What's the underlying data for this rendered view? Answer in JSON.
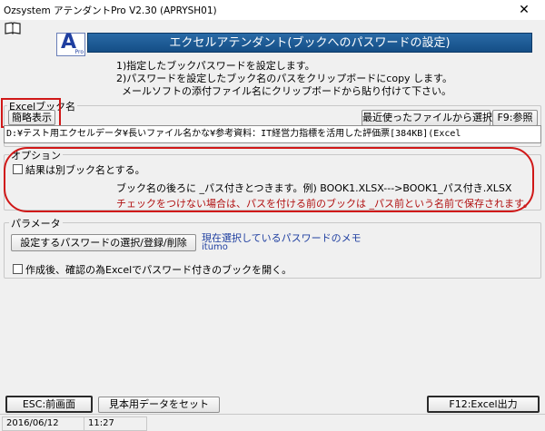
{
  "window": {
    "title": "Ozsystem アテンダントPro V2.30 (APRYSH01)",
    "close_glyph": "✕"
  },
  "header": {
    "logo_letter": "A",
    "logo_sub": "Pro",
    "banner": "エクセルアテンダント(ブックへのパスワードの設定)"
  },
  "instructions": [
    "1)指定したブックパスワードを設定します。",
    "2)パスワードを設定したブック名のパスをクリップボードにcopy します。",
    "メールソフトの添付ファイル名にクリップボードから貼り付けて下さい。"
  ],
  "excel_book": {
    "legend": "Excelブック名",
    "short_display_button": "簡略表示",
    "recent_button": "最近使ったファイルから選択",
    "browse_button": "F9:参照",
    "path_value": "D:¥テスト用エクセルデータ¥長いファイル名かな¥参考資料：IT経営力指標を活用した評価票[384KB](Excel"
  },
  "options": {
    "legend": "オプション",
    "separate_book_label": "結果は別ブック名とする。",
    "note1": "ブック名の後ろに _パス付きとつきます。例) BOOK1.XLSX--->BOOK1_パス付き.XLSX",
    "note2": "チェックをつけない場合は、パスを付ける前のブックは _パス前という名前で保存されます。"
  },
  "params": {
    "legend": "パラメータ",
    "select_password_button": "設定するパスワードの選択/登録/削除",
    "memo_label": "現在選択しているパスワードのメモ",
    "memo_value": "itumo",
    "open_after_label": "作成後、確認の為Excelでパスワード付きのブックを開く。"
  },
  "footer": {
    "esc_button": "ESC:前画面",
    "sample_button": "見本用データをセット",
    "f12_button": "F12:Excel出力"
  },
  "status": {
    "date": "2016/06/12",
    "time": "11:27"
  },
  "colors": {
    "banner": "#1c5a96",
    "highlight": "#d01818",
    "note_red": "#b01010",
    "memo_blue": "#1f3fa0"
  }
}
